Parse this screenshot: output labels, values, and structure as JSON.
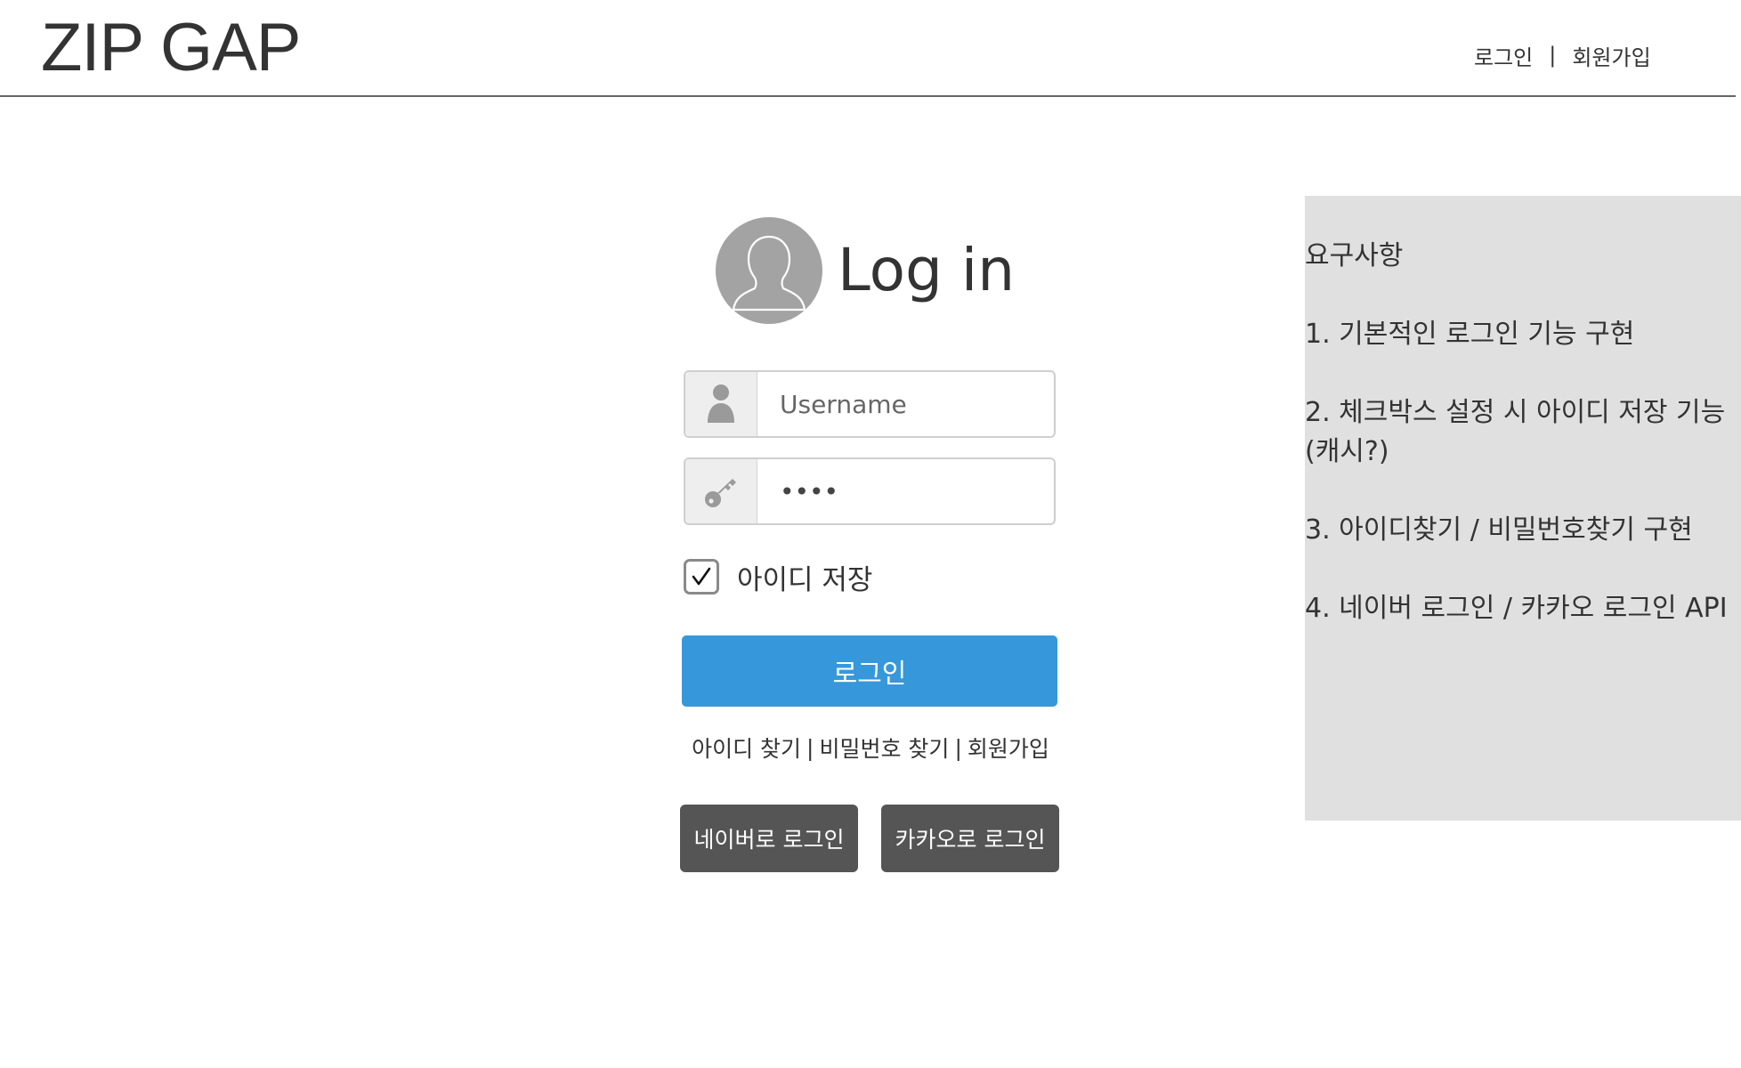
{
  "header": {
    "logo": "ZIP GAP",
    "nav": {
      "login": "로그인",
      "separator": "|",
      "signup": "회원가입"
    }
  },
  "login": {
    "title": "Log in",
    "username": {
      "placeholder": "Username",
      "value": ""
    },
    "password": {
      "value": "1234"
    },
    "remember": {
      "label": "아이디 저장",
      "checked": true
    },
    "submit_label": "로그인",
    "links": {
      "find_id": "아이디 찾기",
      "find_pw": "비밀번호 찾기",
      "signup": "회원가입",
      "separator": "|"
    },
    "social": {
      "naver": "네이버로 로그인",
      "kakao": "카카오로 로그인"
    }
  },
  "requirements": {
    "title": "요구사항",
    "items": [
      "1. 기본적인 로그인 기능 구현",
      "2. 체크박스 설정 시 아이디 저장 기능",
      "(캐시?)",
      "3. 아이디찾기 / 비밀번호찾기 구현",
      "4. 네이버 로그인 / 카카오 로그인 API"
    ]
  },
  "colors": {
    "primary_button": "#3698db",
    "social_button": "#555555",
    "panel_bg": "#e0e0e0",
    "avatar_bg": "#a3a3a3"
  },
  "icons": {
    "avatar": "user-silhouette-icon",
    "username": "user-icon",
    "password": "key-icon",
    "remember": "check-icon"
  }
}
